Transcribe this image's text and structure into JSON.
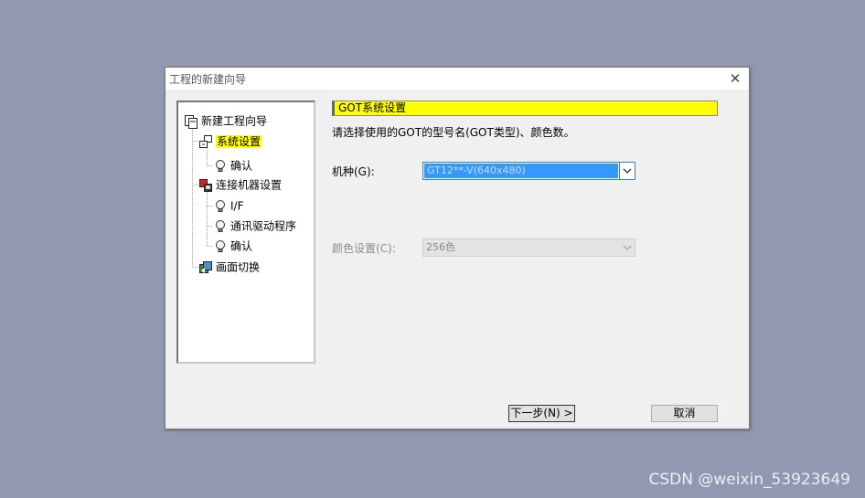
{
  "window": {
    "title": "工程的新建向导",
    "close_symbol": "✕"
  },
  "tree": {
    "items": [
      {
        "label": "新建工程向导",
        "icon": "new-project-icon"
      },
      {
        "label": "系统设置",
        "icon": "system-settings-icon",
        "selected": true
      },
      {
        "label": "确认",
        "icon": "lightbulb-icon"
      },
      {
        "label": "连接机器设置",
        "icon": "connected-device-icon"
      },
      {
        "label": "I/F",
        "icon": "lightbulb-icon"
      },
      {
        "label": "通讯驱动程序",
        "icon": "lightbulb-icon"
      },
      {
        "label": "确认",
        "icon": "lightbulb-icon"
      },
      {
        "label": "画面切换",
        "icon": "screen-switch-icon"
      }
    ]
  },
  "main": {
    "section_title": "GOT系统设置",
    "instruction": "请选择使用的GOT的型号名(GOT类型)、颜色数。",
    "model": {
      "label": "机种(G):",
      "value": "GT12**-V(640x480)"
    },
    "color": {
      "label": "颜色设置(C):",
      "value": "256色"
    }
  },
  "buttons": {
    "next": "下一步(N) >",
    "cancel": "取消"
  },
  "watermark": "CSDN @weixin_53923649",
  "colors": {
    "background": "#9099b0",
    "highlight_yellow": "#ffff00",
    "selection_blue": "#3399ff"
  }
}
